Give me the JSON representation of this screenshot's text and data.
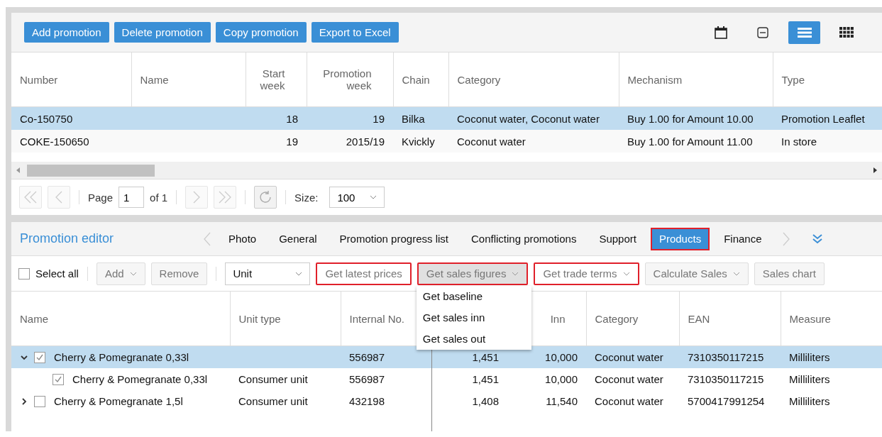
{
  "toolbar": {
    "buttons": [
      "Add promotion",
      "Delete promotion",
      "Copy promotion",
      "Export to Excel"
    ],
    "views": [
      {
        "selected": false
      },
      {
        "selected": false
      },
      {
        "selected": true
      },
      {
        "selected": false
      }
    ]
  },
  "promotions": {
    "columns": [
      "Number",
      "Name",
      "Start week",
      "Promotion week",
      "Chain",
      "Category",
      "Mechanism",
      "Type"
    ],
    "rows": [
      {
        "selected": true,
        "cells": [
          "Co-150750",
          "",
          "18",
          "19",
          "Bilka",
          "Coconut water, Coconut water",
          "Buy 1.00 for Amount 10.00",
          "Promotion Leaflet"
        ]
      },
      {
        "selected": false,
        "cells": [
          "COKE-150650",
          "",
          "19",
          "2015/19",
          "Kvickly",
          "Coconut water",
          "Buy 1.00 for Amount 11.00",
          "In store"
        ]
      }
    ]
  },
  "pager": {
    "page_label": "Page",
    "page": "1",
    "of": "of 1",
    "size_label": "Size:",
    "size": "100"
  },
  "editor": {
    "title": "Promotion editor",
    "tabs": [
      {
        "label": "Photo",
        "selected": false,
        "highlighted": false
      },
      {
        "label": "General",
        "selected": false,
        "highlighted": false
      },
      {
        "label": "Promotion progress list",
        "selected": false,
        "highlighted": false
      },
      {
        "label": "Conflicting promotions",
        "selected": false,
        "highlighted": false
      },
      {
        "label": "Support",
        "selected": false,
        "highlighted": false
      },
      {
        "label": "Products",
        "selected": true,
        "highlighted": true
      },
      {
        "label": "Finance",
        "selected": false,
        "highlighted": false
      }
    ],
    "toolbar": [
      {
        "kind": "checkbox",
        "label": "Select all",
        "checked": false
      },
      {
        "kind": "menu",
        "label": "Add",
        "highlighted": false
      },
      {
        "kind": "button",
        "label": "Remove",
        "highlighted": false
      },
      {
        "kind": "select",
        "value": "Unit"
      },
      {
        "kind": "button",
        "label": "Get latest prices",
        "highlighted": true
      },
      {
        "kind": "menu",
        "label": "Get sales figures",
        "highlighted": true,
        "open": true,
        "items": [
          "Get baseline",
          "Get sales inn",
          "Get sales out"
        ]
      },
      {
        "kind": "menu",
        "label": "Get trade terms",
        "highlighted": true
      },
      {
        "kind": "menu",
        "label": "Calculate Sales",
        "highlighted": false
      },
      {
        "kind": "button",
        "label": "Sales chart",
        "highlighted": false
      }
    ],
    "products": {
      "columns": [
        "Name",
        "Unit type",
        "Internal No.",
        "",
        "Inn",
        "Category",
        "EAN",
        "Measure"
      ],
      "rows": [
        {
          "checked": true,
          "expanded": true,
          "selected": true,
          "cells": [
            "Cherry & Pomegranate 0,33l",
            "",
            "556987",
            "1,451",
            "10,000",
            "Coconut water",
            "7310350117215",
            "Milliliters"
          ],
          "children": [
            {
              "checked": true,
              "selected": false,
              "cells": [
                "Cherry & Pomegranate 0,33l",
                "Consumer unit",
                "556987",
                "1,451",
                "10,000",
                "Coconut water",
                "7310350117215",
                "Milliliters"
              ]
            }
          ]
        },
        {
          "checked": false,
          "expanded": false,
          "selected": false,
          "cells": [
            "Cherry & Pomegranate 1,5l",
            "Consumer unit",
            "432198",
            "1,408",
            "11,540",
            "Coconut water",
            "5700417991254",
            "Milliliters"
          ]
        }
      ]
    }
  }
}
